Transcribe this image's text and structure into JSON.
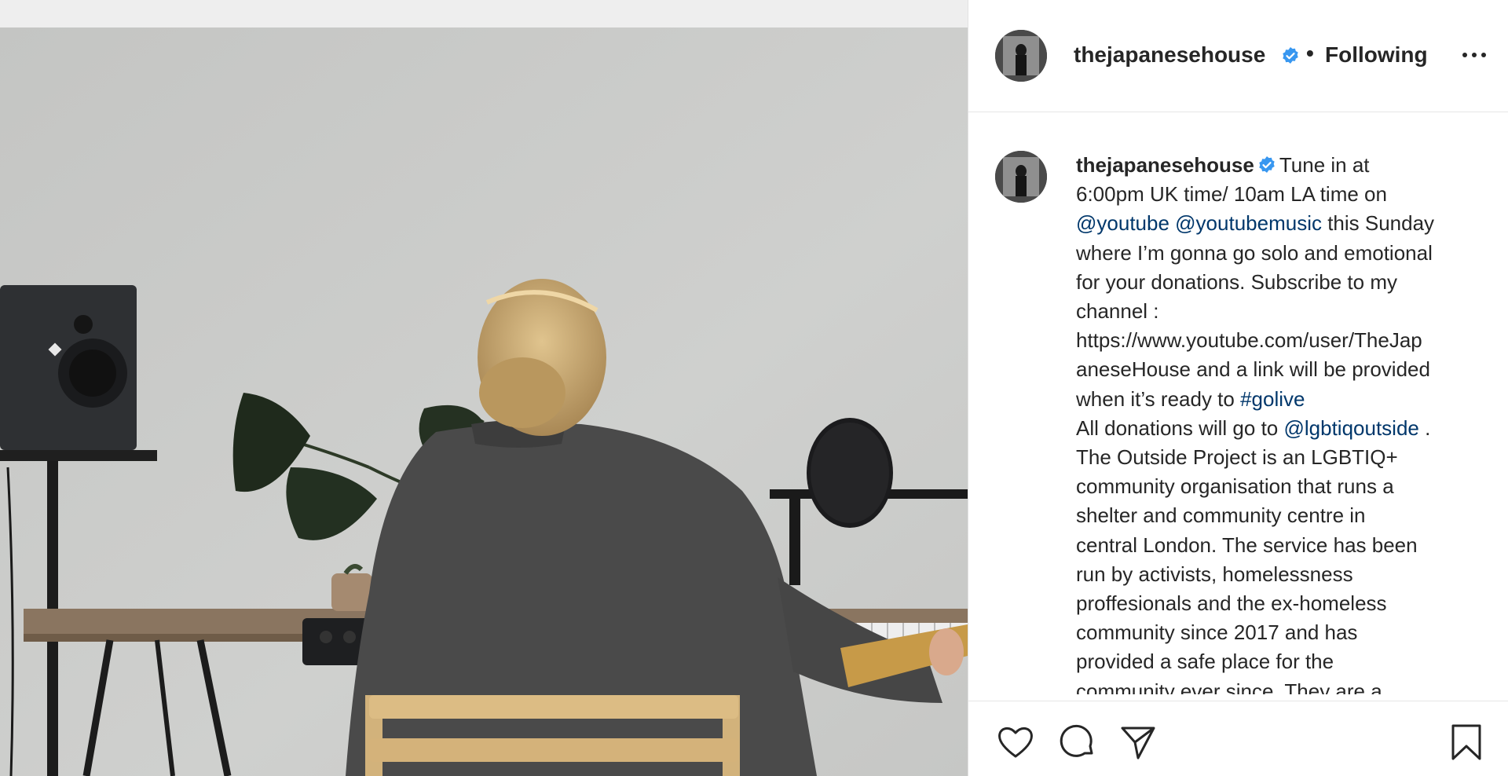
{
  "header": {
    "username": "thejapanesehouse",
    "separator": "•",
    "follow_label": "Following"
  },
  "caption": {
    "username": "thejapanesehouse",
    "lines": [
      [
        {
          "t": "Tune in at"
        }
      ],
      [
        {
          "t": "6:00pm UK time/ 10am LA time on"
        }
      ],
      [
        {
          "t": "@youtube",
          "link": true
        },
        {
          "t": " "
        },
        {
          "t": "@youtubemusic",
          "link": true
        },
        {
          "t": " this Sunday"
        }
      ],
      [
        {
          "t": "where I’m gonna go solo and emotional"
        }
      ],
      [
        {
          "t": "for your donations. Subscribe to my"
        }
      ],
      [
        {
          "t": "channel :"
        }
      ],
      [
        {
          "t": "https://www.youtube.com/user/TheJap"
        }
      ],
      [
        {
          "t": "aneseHouse and a link will be provided"
        }
      ],
      [
        {
          "t": "when it’s ready to "
        },
        {
          "t": "#golive",
          "link": true
        }
      ],
      [
        {
          "t": "All donations will go to "
        },
        {
          "t": "@lgbtiqoutside",
          "link": true
        },
        {
          "t": " ."
        }
      ],
      [
        {
          "t": "The Outside Project is an LGBTIQ+"
        }
      ],
      [
        {
          "t": "community organisation that runs a"
        }
      ],
      [
        {
          "t": "shelter and community centre in"
        }
      ],
      [
        {
          "t": "central London. The service has been"
        }
      ],
      [
        {
          "t": "run by activists, homelessness"
        }
      ],
      [
        {
          "t": "proffesionals and the ex-homeless"
        }
      ],
      [
        {
          "t": "community since 2017 and has"
        }
      ],
      [
        {
          "t": "provided a safe place for the"
        }
      ],
      [
        {
          "t": "community ever since. They are a"
        }
      ]
    ]
  },
  "icons": {
    "verified": "verified-badge-icon",
    "more": "more-options-icon",
    "like": "heart-icon",
    "comment": "comment-bubble-icon",
    "share": "paper-plane-icon",
    "save": "bookmark-icon"
  },
  "colors": {
    "verified": "#3897f0",
    "link": "#00376b",
    "text": "#262626",
    "wall": "#c9cac8"
  }
}
